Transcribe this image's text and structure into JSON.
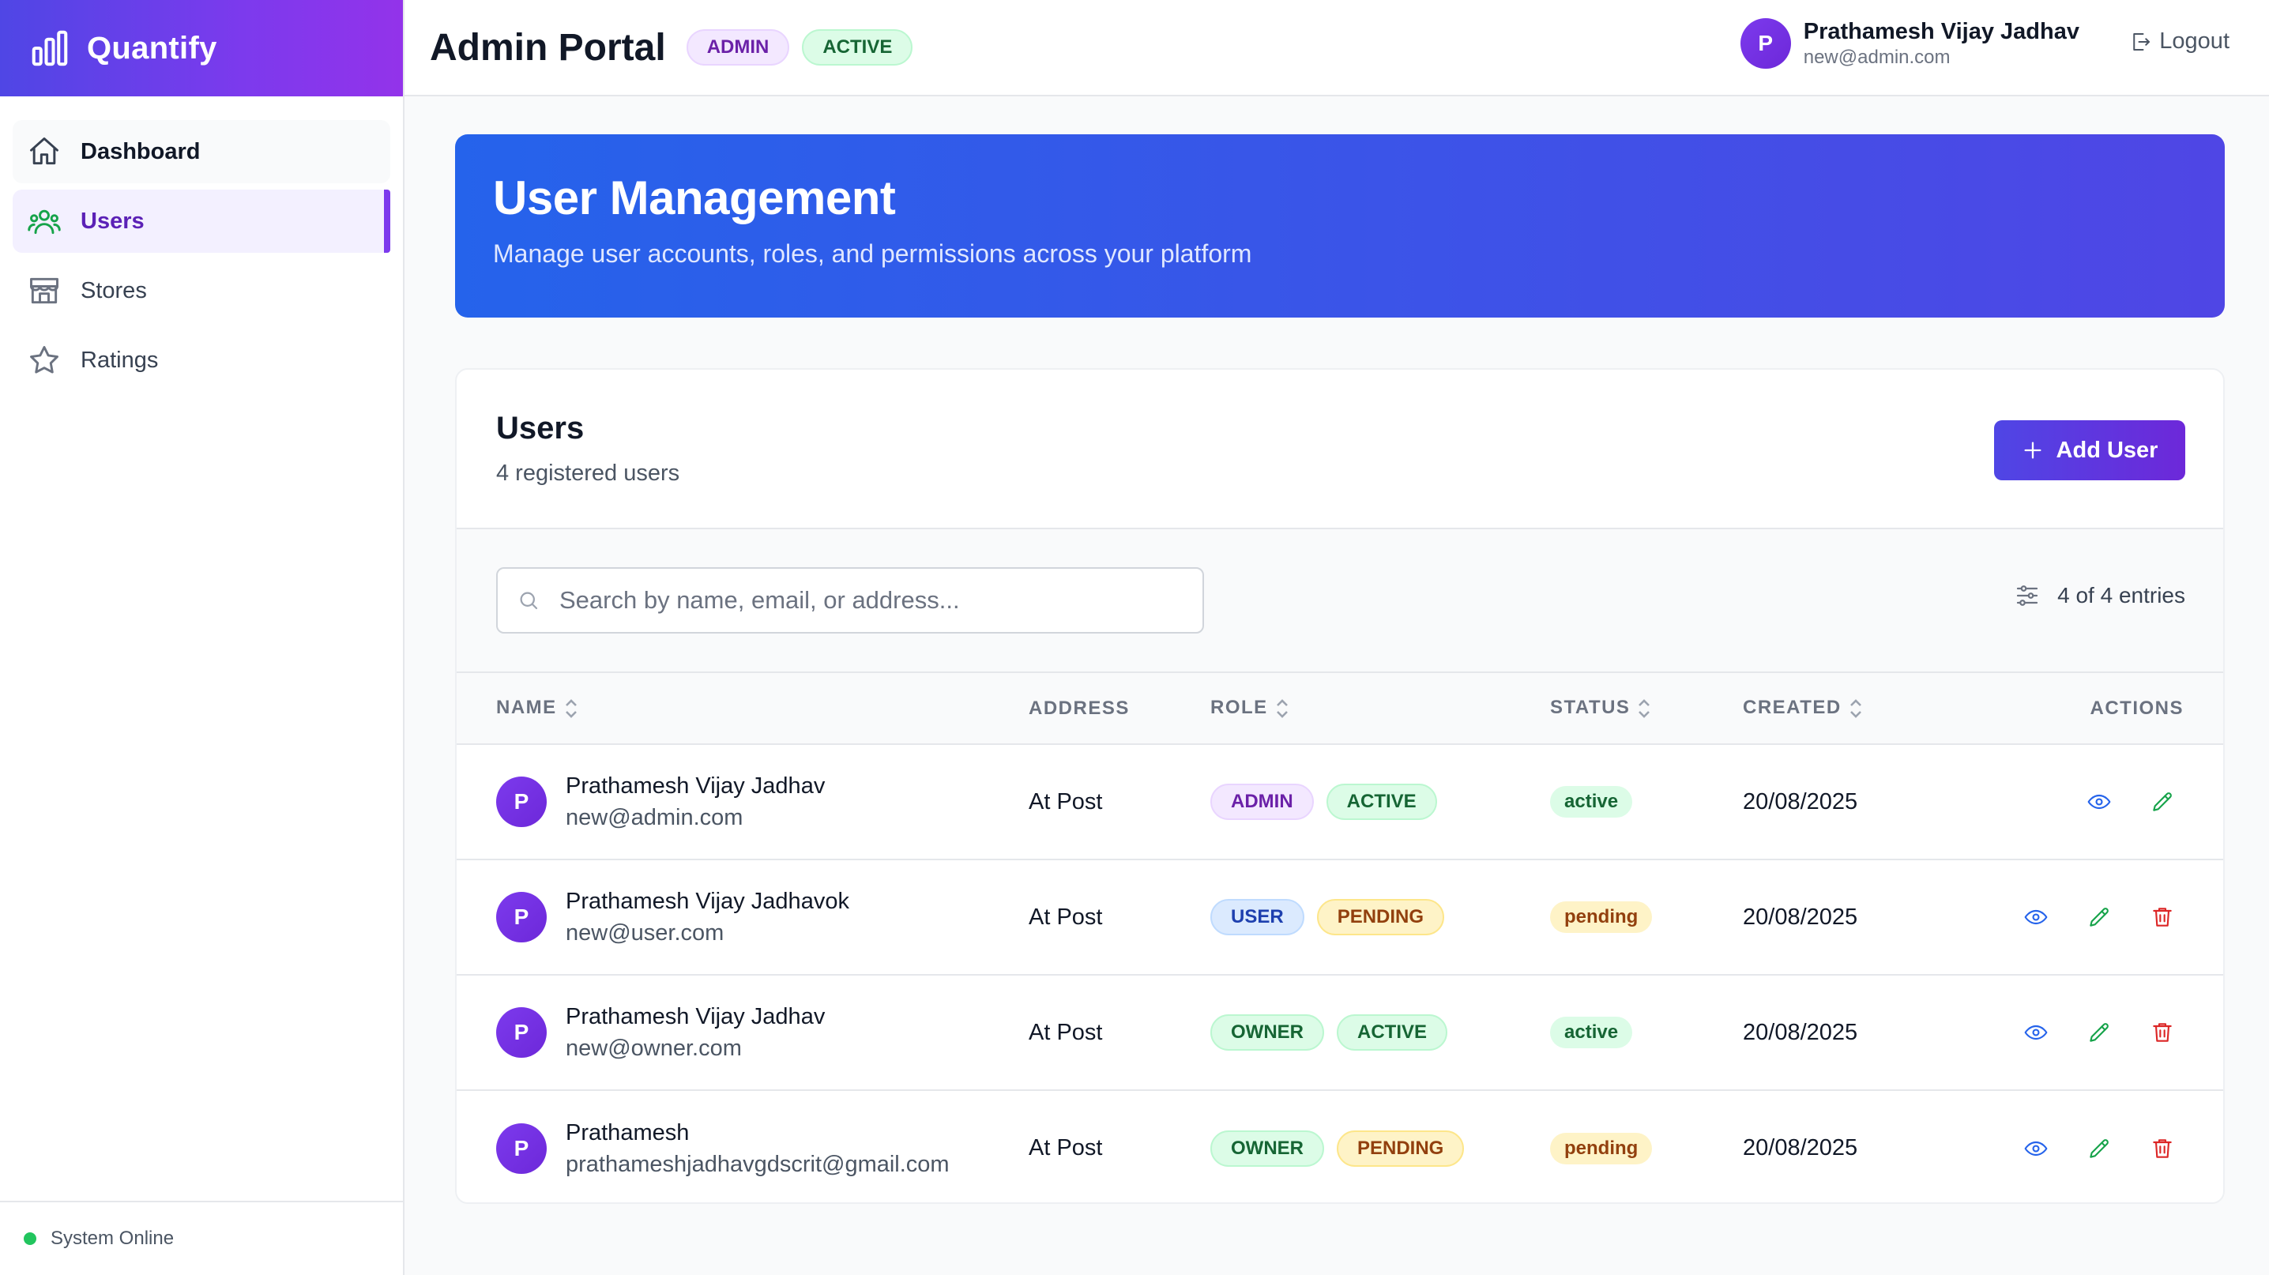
{
  "brand": {
    "name": "Quantify"
  },
  "sidebar": {
    "items": [
      {
        "label": "Dashboard",
        "icon": "home-icon"
      },
      {
        "label": "Users",
        "icon": "users-icon"
      },
      {
        "label": "Stores",
        "icon": "store-icon"
      },
      {
        "label": "Ratings",
        "icon": "star-icon"
      }
    ],
    "status": "System Online"
  },
  "header": {
    "title": "Admin Portal",
    "badges": [
      "ADMIN",
      "ACTIVE"
    ],
    "user": {
      "initial": "P",
      "name": "Prathamesh Vijay Jadhav",
      "email": "new@admin.com"
    },
    "logout_label": "Logout"
  },
  "banner": {
    "title": "User Management",
    "subtitle": "Manage user accounts, roles, and permissions across your platform"
  },
  "card": {
    "title": "Users",
    "subtitle": "4 registered users",
    "add_label": "Add User",
    "search_placeholder": "Search by name, email, or address...",
    "entries_text": "4 of 4 entries"
  },
  "table": {
    "columns": [
      "NAME",
      "ADDRESS",
      "ROLE",
      "STATUS",
      "CREATED",
      "ACTIONS"
    ],
    "rows": [
      {
        "initial": "P",
        "name": "Prathamesh Vijay Jadhav",
        "email": "new@admin.com",
        "address": "At Post",
        "role": "ADMIN",
        "state": "ACTIVE",
        "status": "active",
        "created": "20/08/2025",
        "deletable": false
      },
      {
        "initial": "P",
        "name": "Prathamesh Vijay Jadhavok",
        "email": "new@user.com",
        "address": "At Post",
        "role": "USER",
        "state": "PENDING",
        "status": "pending",
        "created": "20/08/2025",
        "deletable": true
      },
      {
        "initial": "P",
        "name": "Prathamesh Vijay Jadhav",
        "email": "new@owner.com",
        "address": "At Post",
        "role": "OWNER",
        "state": "ACTIVE",
        "status": "active",
        "created": "20/08/2025",
        "deletable": true
      },
      {
        "initial": "P",
        "name": "Prathamesh",
        "email": "prathameshjadhavgdscrit@gmail.com",
        "address": "At Post",
        "role": "OWNER",
        "state": "PENDING",
        "status": "pending",
        "created": "20/08/2025",
        "deletable": true
      }
    ]
  },
  "colors": {
    "brand_gradient_start": "#4f46e5",
    "brand_gradient_end": "#9333ea",
    "banner_start": "#2563eb",
    "banner_end": "#4f46e5",
    "view_icon": "#2563eb",
    "edit_icon": "#16a34a",
    "delete_icon": "#dc2626"
  }
}
